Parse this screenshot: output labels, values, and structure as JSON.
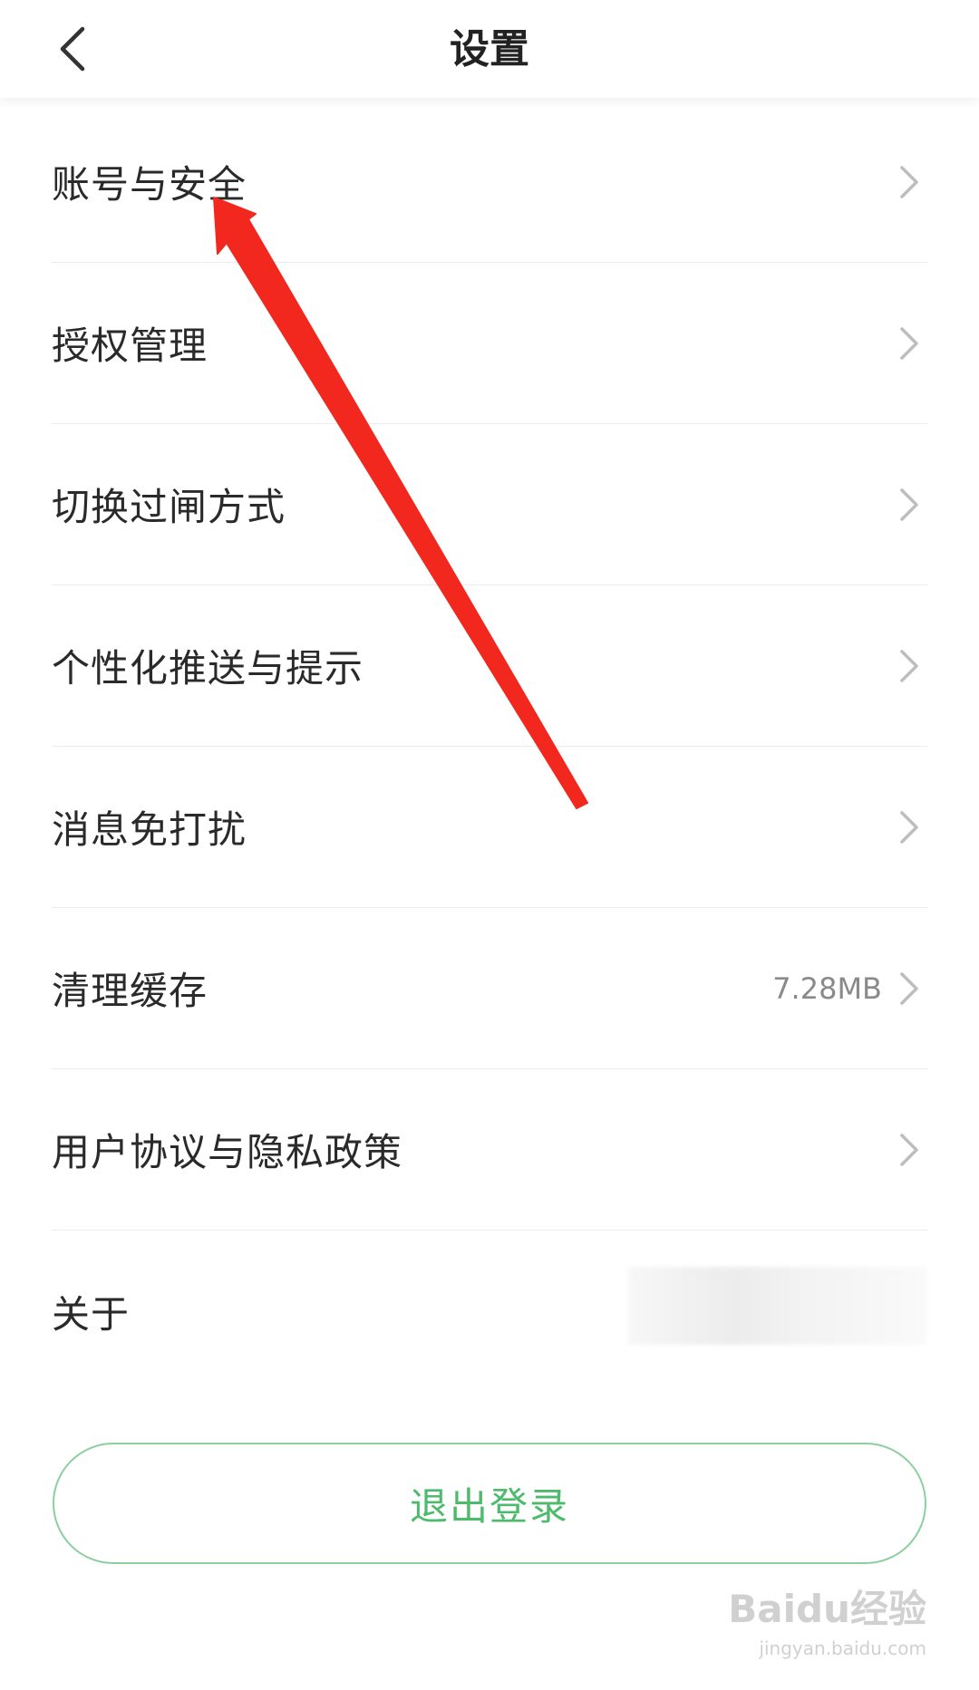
{
  "header": {
    "title": "设置",
    "back_icon": "chevron-left-icon"
  },
  "settings": {
    "items": [
      {
        "label": "账号与安全",
        "value": ""
      },
      {
        "label": "授权管理",
        "value": ""
      },
      {
        "label": "切换过闸方式",
        "value": ""
      },
      {
        "label": "个性化推送与提示",
        "value": ""
      },
      {
        "label": "消息免打扰",
        "value": ""
      },
      {
        "label": "清理缓存",
        "value": "7.28MB"
      },
      {
        "label": "用户协议与隐私政策",
        "value": ""
      },
      {
        "label": "关于",
        "value": ""
      }
    ],
    "chevron_icon": "chevron-right-icon"
  },
  "logout": {
    "label": "退出登录"
  },
  "watermark": {
    "logo": "Baidu经验",
    "url": "jingyan.baidu.com"
  },
  "colors": {
    "accent_green": "#4dbb6b",
    "arrow_red": "#f2271e",
    "divider": "#ececec"
  }
}
